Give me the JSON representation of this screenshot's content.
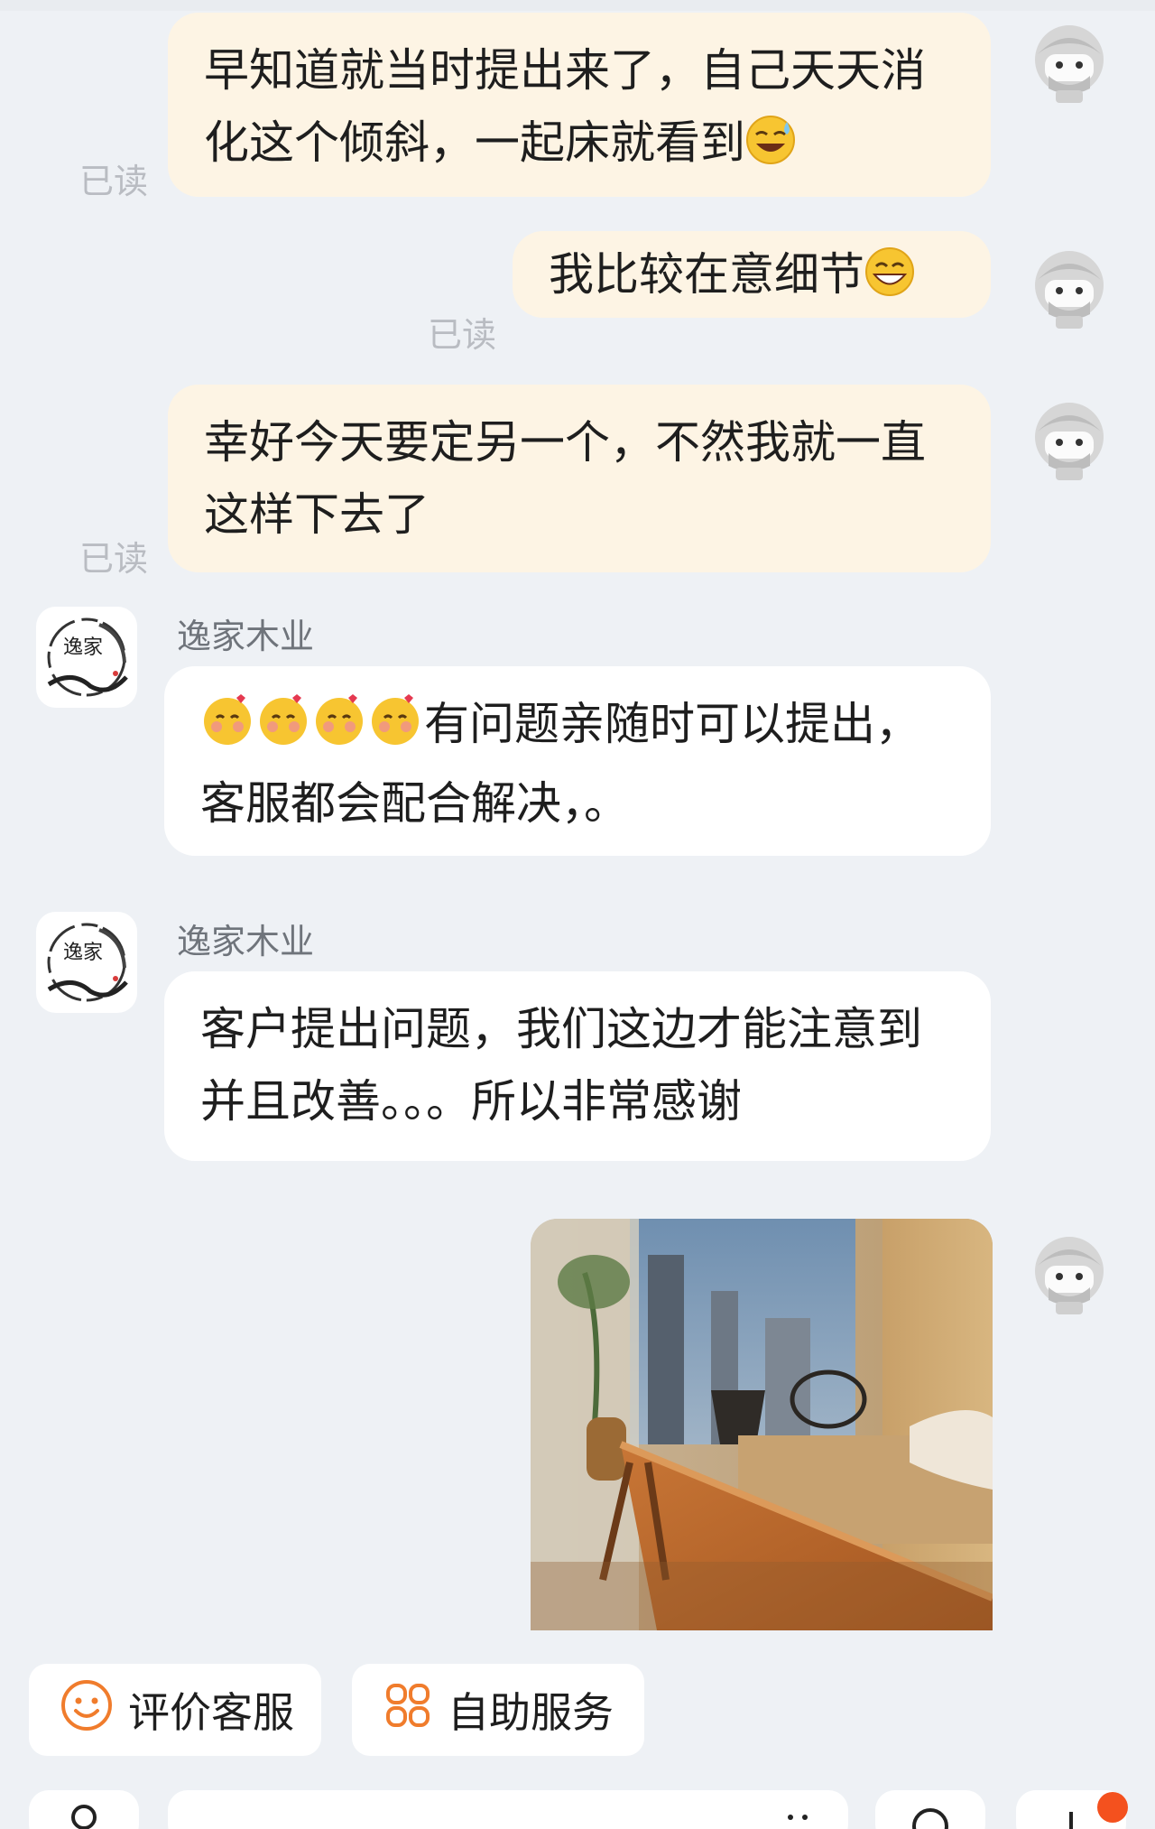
{
  "messages": [
    {
      "text": "早知道就当时提出来了，自己天天消化这个倾斜，一起床就看到",
      "emoji": "sweat-smile",
      "read": "已读"
    },
    {
      "text": "我比较在意细节",
      "emoji": "grin",
      "read": "已读"
    },
    {
      "text": "幸好今天要定另一个，不然我就一直这样下去了",
      "read": "已读"
    },
    {
      "sender": "逸家木业",
      "emoji_count": 4,
      "text": "有问题亲随时可以提出，客服都会配合解决，。"
    },
    {
      "sender": "逸家木业",
      "text": "客户提出问题，我们这边才能注意到并且改善。。。所以非常感谢"
    }
  ],
  "shop_logo_text": "逸家",
  "quick_actions": [
    {
      "label": "评价客服",
      "icon": "smiley-icon"
    },
    {
      "label": "自助服务",
      "icon": "grid-flower-icon"
    }
  ],
  "colors": {
    "background": "#eef1f5",
    "my_bubble": "#fdf4e4",
    "their_bubble": "#ffffff",
    "accent": "#f07c2c",
    "notification": "#f4511e"
  }
}
